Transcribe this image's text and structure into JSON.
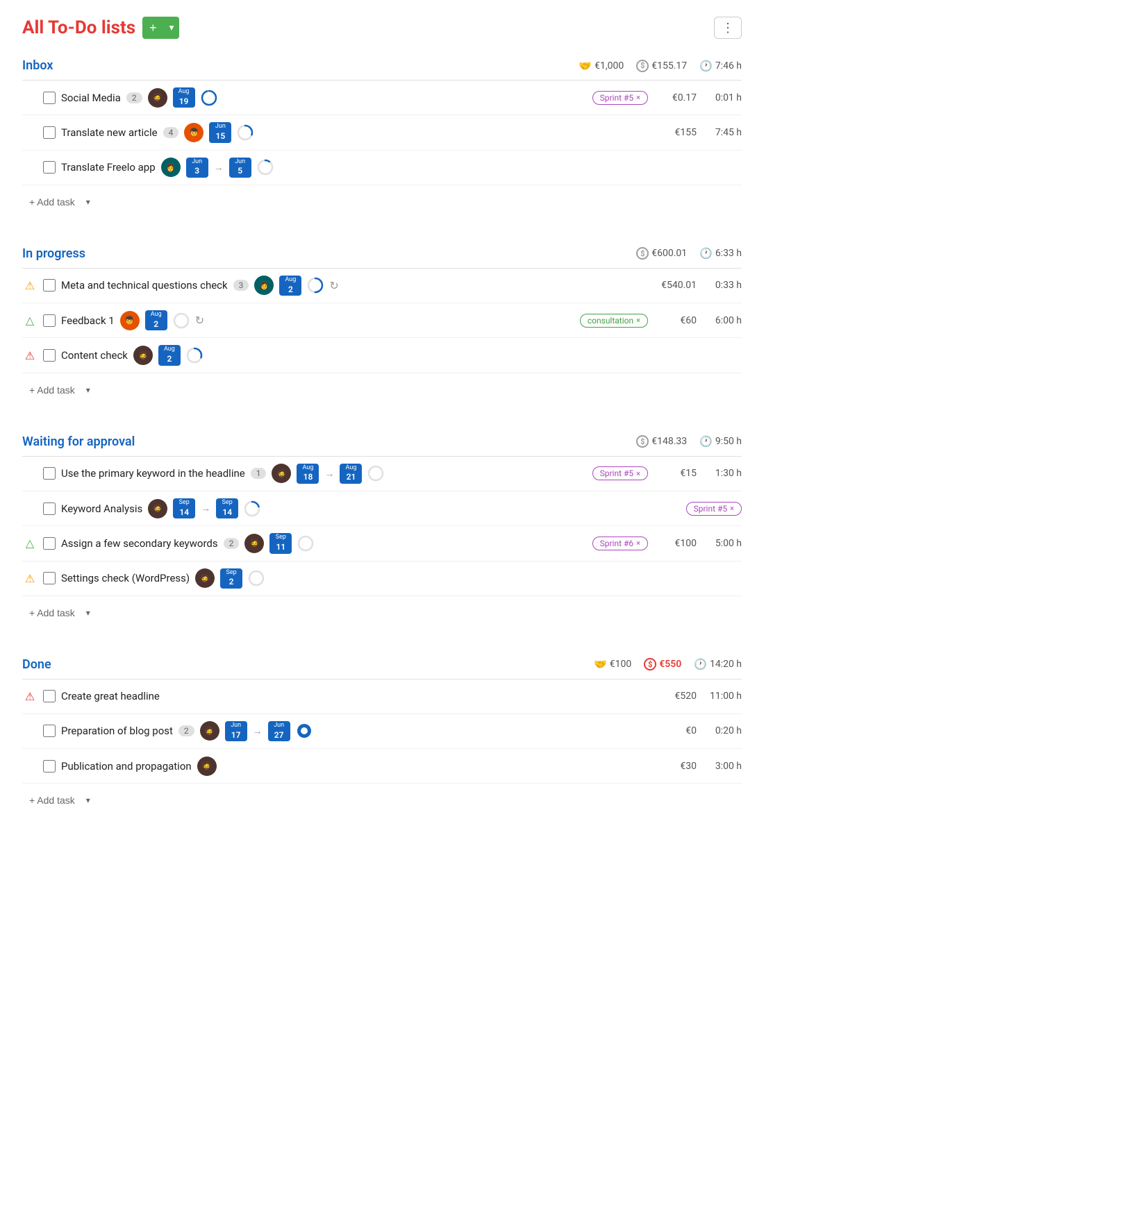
{
  "page": {
    "title": "All To-Do lists"
  },
  "header": {
    "add_label": "+",
    "dropdown_label": "▾",
    "more_label": "⋮"
  },
  "sections": [
    {
      "id": "inbox",
      "title": "Inbox",
      "meta": {
        "budget_icon": "hand",
        "budget": "€1,000",
        "cost_icon": "dollar",
        "cost": "€155.17",
        "time_icon": "clock",
        "time": "7:46 h"
      },
      "tasks": [
        {
          "name": "Social Media",
          "count": "2",
          "avatar": "dark",
          "date": {
            "month": "Aug",
            "day": "19"
          },
          "progress": 95,
          "tag": "Sprint #5",
          "tag_type": "sprint",
          "cost": "€0.17",
          "time": "0:01 h",
          "warning": ""
        },
        {
          "name": "Translate new article",
          "count": "4",
          "avatar": "orange",
          "date": {
            "month": "Jun",
            "day": "15"
          },
          "progress": 30,
          "tag": "",
          "tag_type": "",
          "cost": "€155",
          "time": "7:45 h",
          "warning": ""
        },
        {
          "name": "Translate Freelo app",
          "count": "",
          "avatar": "teal",
          "date_from": {
            "month": "Jun",
            "day": "3"
          },
          "date_to": {
            "month": "Jun",
            "day": "5"
          },
          "progress": 10,
          "tag": "",
          "tag_type": "",
          "cost": "",
          "time": "",
          "warning": ""
        }
      ],
      "add_task_label": "+ Add task"
    },
    {
      "id": "in-progress",
      "title": "In progress",
      "meta": {
        "budget_icon": "dollar",
        "budget": "€600.01",
        "time_icon": "clock",
        "time": "6:33 h"
      },
      "tasks": [
        {
          "name": "Meta and technical questions check",
          "count": "3",
          "avatar": "teal",
          "date": {
            "month": "Aug",
            "day": "2"
          },
          "progress": 50,
          "show_refresh": true,
          "tag": "",
          "tag_type": "",
          "cost": "€540.01",
          "time": "0:33 h",
          "warning": "orange"
        },
        {
          "name": "Feedback 1",
          "count": "",
          "avatar": "orange",
          "date": {
            "month": "Aug",
            "day": "2"
          },
          "show_refresh": true,
          "progress": 0,
          "tag": "consultation",
          "tag_type": "consultation",
          "cost": "€60",
          "time": "6:00 h",
          "warning": "green"
        },
        {
          "name": "Content check",
          "count": "",
          "avatar": "dark",
          "date": {
            "month": "Aug",
            "day": "2"
          },
          "progress": 30,
          "tag": "",
          "tag_type": "",
          "cost": "",
          "time": "",
          "warning": "red"
        }
      ],
      "add_task_label": "+ Add task"
    },
    {
      "id": "waiting-approval",
      "title": "Waiting for approval",
      "meta": {
        "budget_icon": "dollar",
        "budget": "€148.33",
        "time_icon": "clock",
        "time": "9:50 h"
      },
      "tasks": [
        {
          "name": "Use the primary keyword in the headline",
          "count": "1",
          "avatar": "dark",
          "date_from": {
            "month": "Aug",
            "day": "18"
          },
          "date_to": {
            "month": "Aug",
            "day": "21"
          },
          "progress": 0,
          "tag": "Sprint #5",
          "tag_type": "sprint",
          "cost": "€15",
          "time": "1:30 h",
          "warning": ""
        },
        {
          "name": "Keyword Analysis",
          "count": "",
          "avatar": "dark",
          "date_from": {
            "month": "Sep",
            "day": "14"
          },
          "date_to": {
            "month": "Sep",
            "day": "14"
          },
          "progress": 20,
          "tag": "Sprint #5",
          "tag_type": "sprint",
          "cost": "",
          "time": "",
          "warning": ""
        },
        {
          "name": "Assign a few secondary keywords",
          "count": "2",
          "avatar": "dark",
          "date": {
            "month": "Sep",
            "day": "11"
          },
          "progress": 0,
          "tag": "Sprint #6",
          "tag_type": "sprint6",
          "cost": "€100",
          "time": "5:00 h",
          "warning": "green"
        },
        {
          "name": "Settings check (WordPress)",
          "count": "",
          "avatar": "dark",
          "date": {
            "month": "Sep",
            "day": "2"
          },
          "progress": 0,
          "tag": "",
          "tag_type": "",
          "cost": "",
          "time": "",
          "warning": "orange"
        }
      ],
      "add_task_label": "+ Add task"
    },
    {
      "id": "done",
      "title": "Done",
      "meta": {
        "budget_icon": "hand",
        "budget": "€100",
        "cost_icon": "dollar-red",
        "cost": "€550",
        "time_icon": "clock",
        "time": "14:20 h"
      },
      "tasks": [
        {
          "name": "Create great headline",
          "count": "",
          "avatar": "",
          "progress": 0,
          "tag": "",
          "tag_type": "",
          "cost": "€520",
          "time": "11:00 h",
          "warning": "red"
        },
        {
          "name": "Preparation of blog post",
          "count": "2",
          "avatar": "dark",
          "date_from": {
            "month": "Jun",
            "day": "17"
          },
          "date_to": {
            "month": "Jun",
            "day": "27"
          },
          "progress": 100,
          "tag": "",
          "tag_type": "",
          "cost": "€0",
          "time": "0:20 h",
          "warning": ""
        },
        {
          "name": "Publication and propagation",
          "count": "",
          "avatar": "dark",
          "progress": 0,
          "tag": "",
          "tag_type": "",
          "cost": "€30",
          "time": "3:00 h",
          "warning": ""
        }
      ],
      "add_task_label": "+ Add task"
    }
  ]
}
